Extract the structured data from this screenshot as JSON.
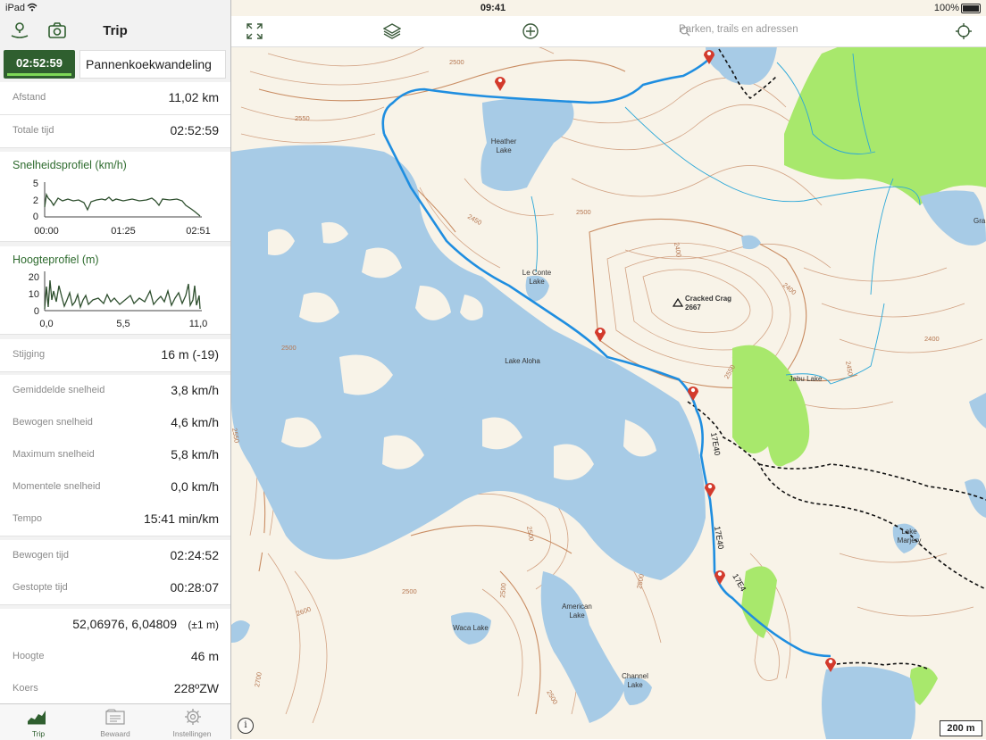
{
  "status": {
    "device": "iPad",
    "time": "09:41",
    "battery": "100%"
  },
  "sidebar": {
    "title": "Trip",
    "timer": "02:52:59",
    "trip_name": "Pannenkoekwandeling",
    "stats1": [
      {
        "label": "Afstand",
        "value": "11,02 km"
      },
      {
        "label": "Totale tijd",
        "value": "02:52:59"
      }
    ],
    "speed_profile": {
      "title": "Snelheidsprofiel (km/h)",
      "y_ticks": [
        "5",
        "2",
        "0"
      ],
      "x_ticks": [
        "00:00",
        "01:25",
        "02:51"
      ]
    },
    "height_profile": {
      "title": "Hoogteprofiel (m)",
      "y_ticks": [
        "20",
        "10",
        "0"
      ],
      "x_ticks": [
        "0,0",
        "5,5",
        "11,0"
      ]
    },
    "climb": {
      "label": "Stijging",
      "value": "16 m (-19)"
    },
    "stats2": [
      {
        "label": "Gemiddelde snelheid",
        "value": "3,8 km/h"
      },
      {
        "label": "Bewogen snelheid",
        "value": "4,6 km/h"
      },
      {
        "label": "Maximum snelheid",
        "value": "5,8 km/h"
      },
      {
        "label": "Momentele snelheid",
        "value": "0,0 km/h"
      },
      {
        "label": "Tempo",
        "value": "15:41 min/km"
      }
    ],
    "stats3": [
      {
        "label": "Bewogen tijd",
        "value": "02:24:52"
      },
      {
        "label": "Gestopte tijd",
        "value": "00:28:07"
      }
    ],
    "coordinates": "52,06976, 6,04809",
    "accuracy": "(±1 m)",
    "stats4": [
      {
        "label": "Hoogte",
        "value": "46 m"
      },
      {
        "label": "Koers",
        "value": "228ºZW"
      }
    ],
    "tabs": [
      {
        "label": "Trip",
        "icon": "chart-icon"
      },
      {
        "label": "Bewaard",
        "icon": "folder-icon"
      },
      {
        "label": "Instellingen",
        "icon": "gear-icon"
      }
    ]
  },
  "map": {
    "search_placeholder": "Parken, trails en adressen",
    "scale": "200 m",
    "labels": {
      "heather": [
        "Heather",
        "Lake"
      ],
      "leconte": [
        "Le Conte",
        "Lake"
      ],
      "aloha": "Lake Aloha",
      "crag": [
        "Cracked Crag",
        "2667"
      ],
      "jabu": "Jabu Lake",
      "marjery": [
        "Lake",
        "Marjery"
      ],
      "american": [
        "American",
        "Lake"
      ],
      "waca": "Waca Lake",
      "channel": [
        "Channel",
        "Lake"
      ],
      "gra": "Gra",
      "contours": [
        "2500",
        "2550",
        "2450",
        "2500",
        "2400",
        "2400",
        "2400",
        "2450",
        "2500",
        "2550",
        "2550",
        "2500",
        "2500",
        "2500",
        "2600",
        "2700",
        "2500",
        "2500"
      ],
      "trail_codes": [
        "17E40",
        "17E40",
        "17E4"
      ]
    },
    "colors": {
      "water": "#a7cbe6",
      "land": "#f8f3e8",
      "forest": "#a8e86c",
      "contour": "#c98c62",
      "route": "#1f8ee0",
      "pin": "#d33a2c"
    }
  }
}
